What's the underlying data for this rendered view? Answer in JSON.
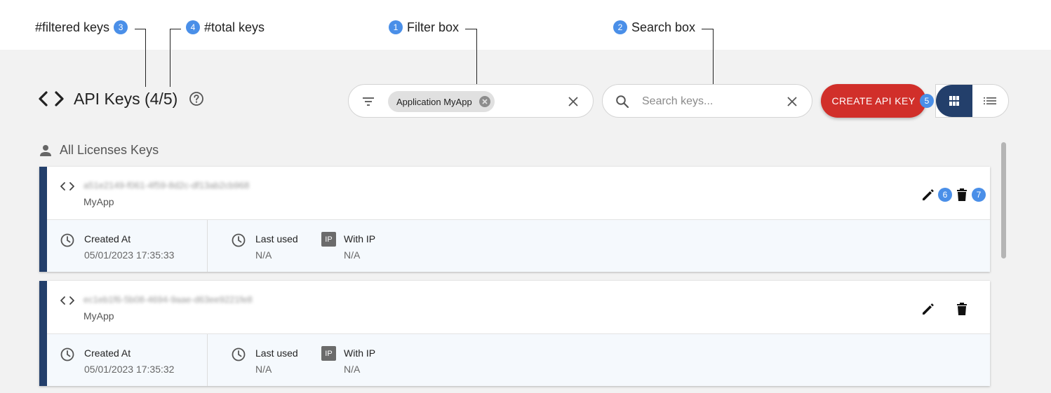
{
  "annotations": {
    "filtered_keys": {
      "label": "#filtered keys",
      "number": "3"
    },
    "total_keys": {
      "label": "#total keys",
      "number": "4"
    },
    "filter_box": {
      "label": "Filter box",
      "number": "1"
    },
    "search_box": {
      "label": "Search box",
      "number": "2"
    },
    "create_button": {
      "number": "5"
    },
    "edit_button": {
      "number": "6"
    },
    "delete_button": {
      "number": "7"
    }
  },
  "header": {
    "title": "API Keys (4/5)",
    "icon": "code-icon",
    "help_icon": "help-circle-icon"
  },
  "filter": {
    "icon": "filter-icon",
    "chip_label": "Application MyApp",
    "clear_icon": "close-icon"
  },
  "search": {
    "icon": "search-icon",
    "placeholder": "Search keys...",
    "value": "",
    "clear_icon": "close-icon"
  },
  "create_button": {
    "label": "CREATE API KEY"
  },
  "view_toggle": {
    "grid_icon": "grid-view-icon",
    "list_icon": "list-view-icon",
    "selected": "grid"
  },
  "section": {
    "title": "All Licenses Keys",
    "icon": "person-icon"
  },
  "keys": [
    {
      "key_id": "a51e2149-f061-4f59-8d2c-df13ab2cb968",
      "app": "MyApp",
      "created_label": "Created At",
      "created_value": "05/01/2023 17:35:33",
      "last_used_label": "Last used",
      "last_used_value": "N/A",
      "ip_label": "With IP",
      "ip_value": "N/A",
      "ip_badge": "IP"
    },
    {
      "key_id": "ec1eb1f6-5b08-4694-9aae-d63ee9221fe8",
      "app": "MyApp",
      "created_label": "Created At",
      "created_value": "05/01/2023 17:35:32",
      "last_used_label": "Last used",
      "last_used_value": "N/A",
      "ip_label": "With IP",
      "ip_value": "N/A",
      "ip_badge": "IP"
    }
  ],
  "colors": {
    "accent": "#233f6b",
    "create": "#d12f2a",
    "badge": "#4a8fe8",
    "background": "#f2f2f2"
  }
}
